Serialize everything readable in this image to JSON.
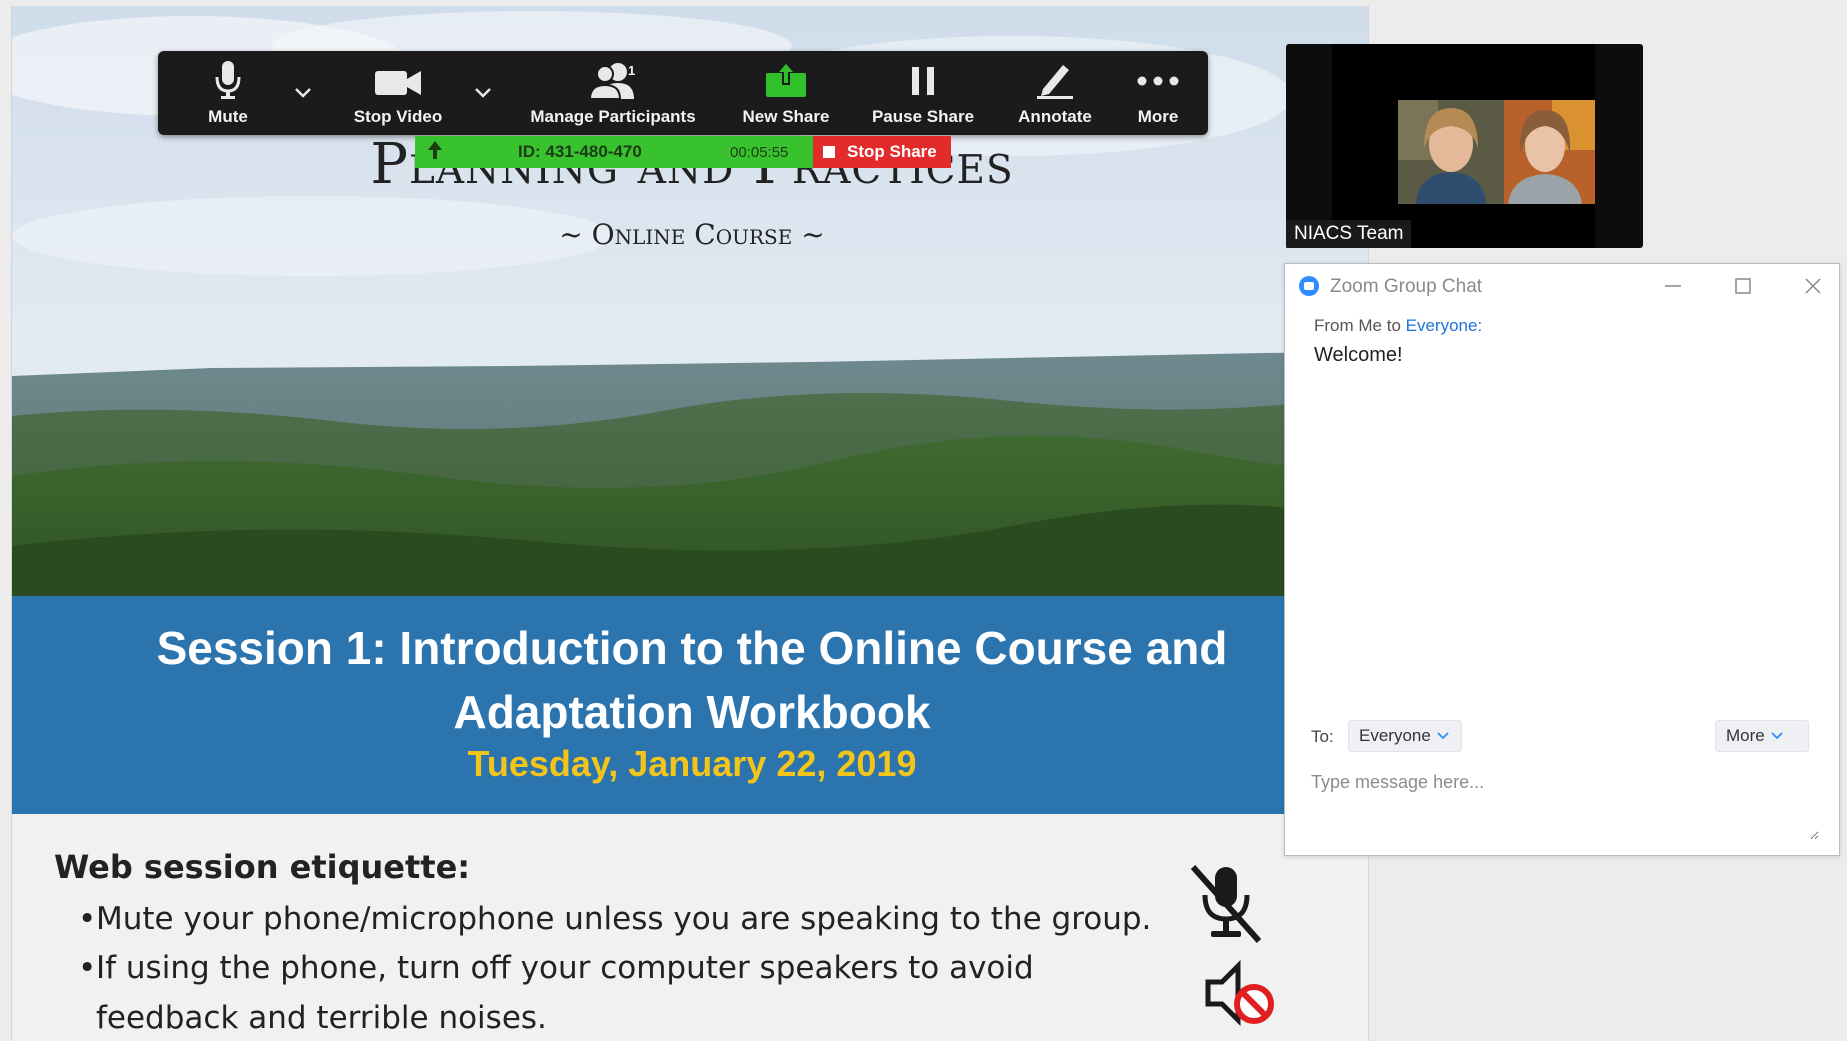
{
  "slide": {
    "title": "Planning and Practices",
    "subtitle": "~ Online Course ~",
    "session_title": "Session 1: Introduction to the Online Course and Adaptation Workbook",
    "session_date": "Tuesday, January 22, 2019",
    "etiquette_heading": "Web session etiquette:",
    "bullets": [
      "Mute your phone/microphone unless you are speaking to the group.",
      "If using the phone, turn off your computer speakers to avoid",
      "feedback and terrible noises."
    ]
  },
  "toolbar": {
    "mute": "Mute",
    "stop_video": "Stop Video",
    "manage_participants": "Manage Participants",
    "participant_count": "1",
    "new_share": "New Share",
    "pause_share": "Pause Share",
    "annotate": "Annotate",
    "more": "More"
  },
  "share_bar": {
    "meeting_id": "ID: 431-480-470",
    "timer": "00:05:55",
    "stop_share": "Stop Share"
  },
  "video": {
    "label": "NIACS Team"
  },
  "chat": {
    "window_title": "Zoom Group Chat",
    "from_prefix": "From Me to ",
    "from_recipient": "Everyone:",
    "message": "Welcome!",
    "to_label": "To:",
    "to_value": "Everyone",
    "more_label": "More",
    "input_placeholder": "Type message here..."
  },
  "colors": {
    "session_band": "#2b74ad",
    "date_yellow": "#f3c51b",
    "share_green": "#37c22e",
    "stop_red": "#e42b2b",
    "chat_link": "#1f73d6"
  }
}
